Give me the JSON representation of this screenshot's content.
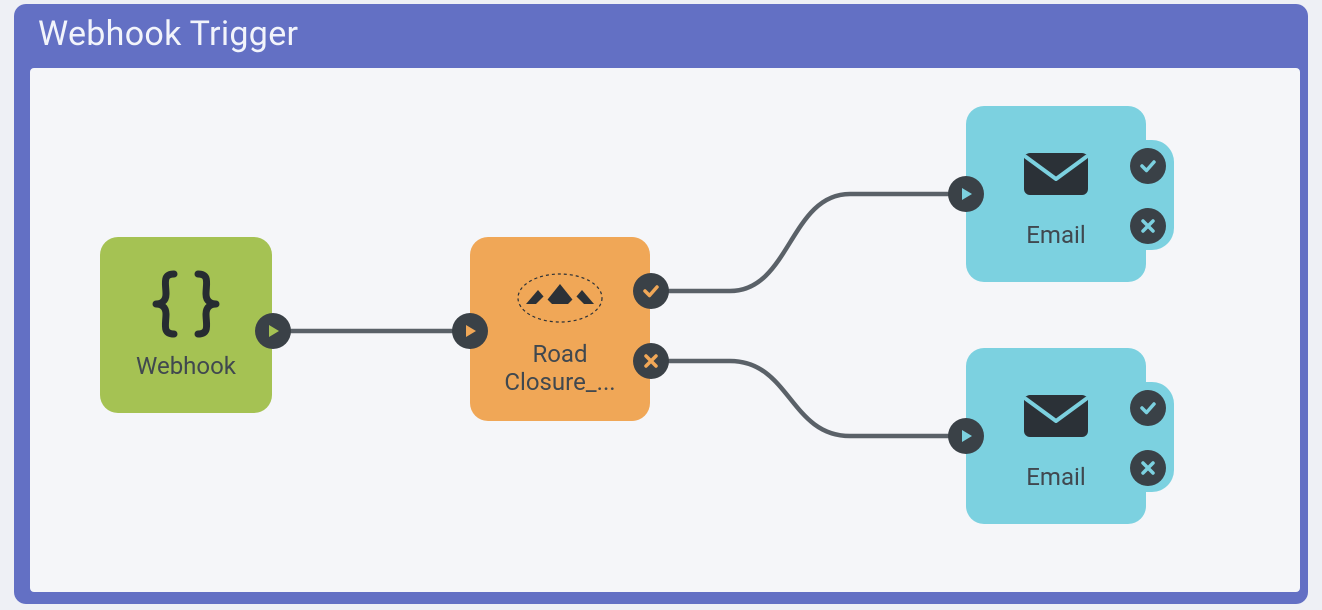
{
  "container": {
    "title": "Webhook Trigger"
  },
  "nodes": {
    "webhook": {
      "label": "Webhook",
      "icon": "braces-icon",
      "color": "#a5c253",
      "ports": {
        "out": "play"
      }
    },
    "road_closure": {
      "label": "Road Closure_...",
      "icon": "fme-logo-icon",
      "color": "#f0a757",
      "ports": {
        "in": "play",
        "out_success": "check",
        "out_fail": "x"
      }
    },
    "email_1": {
      "label": "Email",
      "icon": "envelope-icon",
      "color": "#7cd1e0",
      "ports": {
        "in": "play",
        "out_success": "check",
        "out_fail": "x"
      }
    },
    "email_2": {
      "label": "Email",
      "icon": "envelope-icon",
      "color": "#7cd1e0",
      "ports": {
        "in": "play",
        "out_success": "check",
        "out_fail": "x"
      }
    }
  },
  "connections": [
    {
      "from": "webhook.out",
      "to": "road_closure.in"
    },
    {
      "from": "road_closure.out_success",
      "to": "email_1.in"
    },
    {
      "from": "road_closure.out_fail",
      "to": "email_2.in"
    }
  ],
  "colors": {
    "frame": "#6370c4",
    "canvas": "#f5f6f9",
    "port": "#3a4147",
    "wire": "#5a6168"
  }
}
